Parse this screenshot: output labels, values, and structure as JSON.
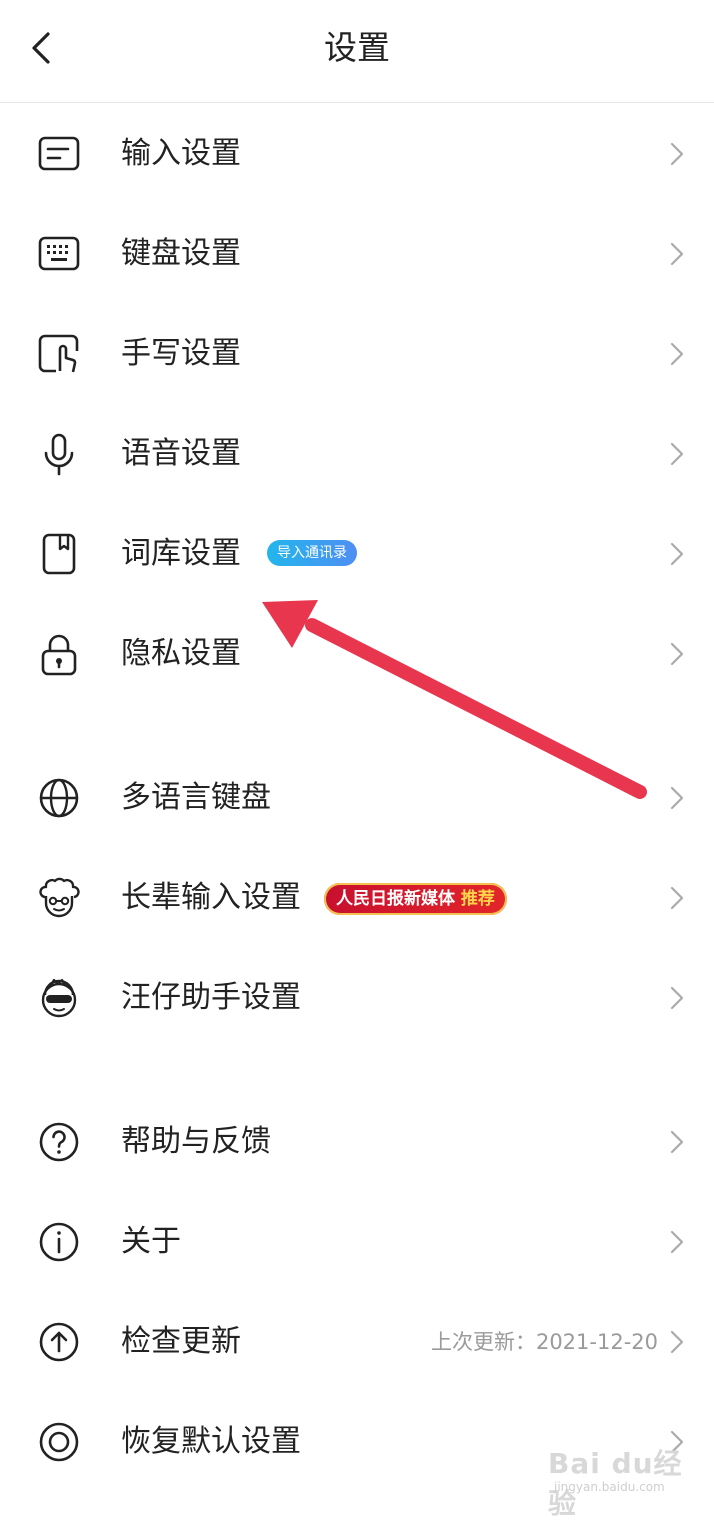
{
  "header": {
    "title": "设置"
  },
  "groups": [
    [
      {
        "label": "输入设置",
        "icon": "text-input-icon"
      },
      {
        "label": "键盘设置",
        "icon": "keyboard-icon"
      },
      {
        "label": "手写设置",
        "icon": "handwriting-icon"
      },
      {
        "label": "语音设置",
        "icon": "microphone-icon"
      },
      {
        "label": "词库设置",
        "icon": "book-icon",
        "badge": "导入通讯录"
      },
      {
        "label": "隐私设置",
        "icon": "lock-icon"
      }
    ],
    [
      {
        "label": "多语言键盘",
        "icon": "globe-icon"
      },
      {
        "label": "长辈输入设置",
        "icon": "elder-face-icon",
        "badge_text": "人民日报新媒体",
        "badge_highlight": "推荐"
      },
      {
        "label": "汪仔助手设置",
        "icon": "assistant-face-icon"
      }
    ],
    [
      {
        "label": "帮助与反馈",
        "icon": "question-icon"
      },
      {
        "label": "关于",
        "icon": "info-icon"
      },
      {
        "label": "检查更新",
        "icon": "upload-arrow-icon",
        "detail": "上次更新：2021-12-20"
      },
      {
        "label": "恢复默认设置",
        "icon": "restore-icon"
      }
    ]
  ],
  "watermark": {
    "brand": "Bai du经验",
    "url": "jingyan.baidu.com"
  },
  "colors": {
    "annotation_arrow": "#e8364f",
    "badge_blue": "#2fa8ee",
    "badge_red": "#d01a2c"
  }
}
